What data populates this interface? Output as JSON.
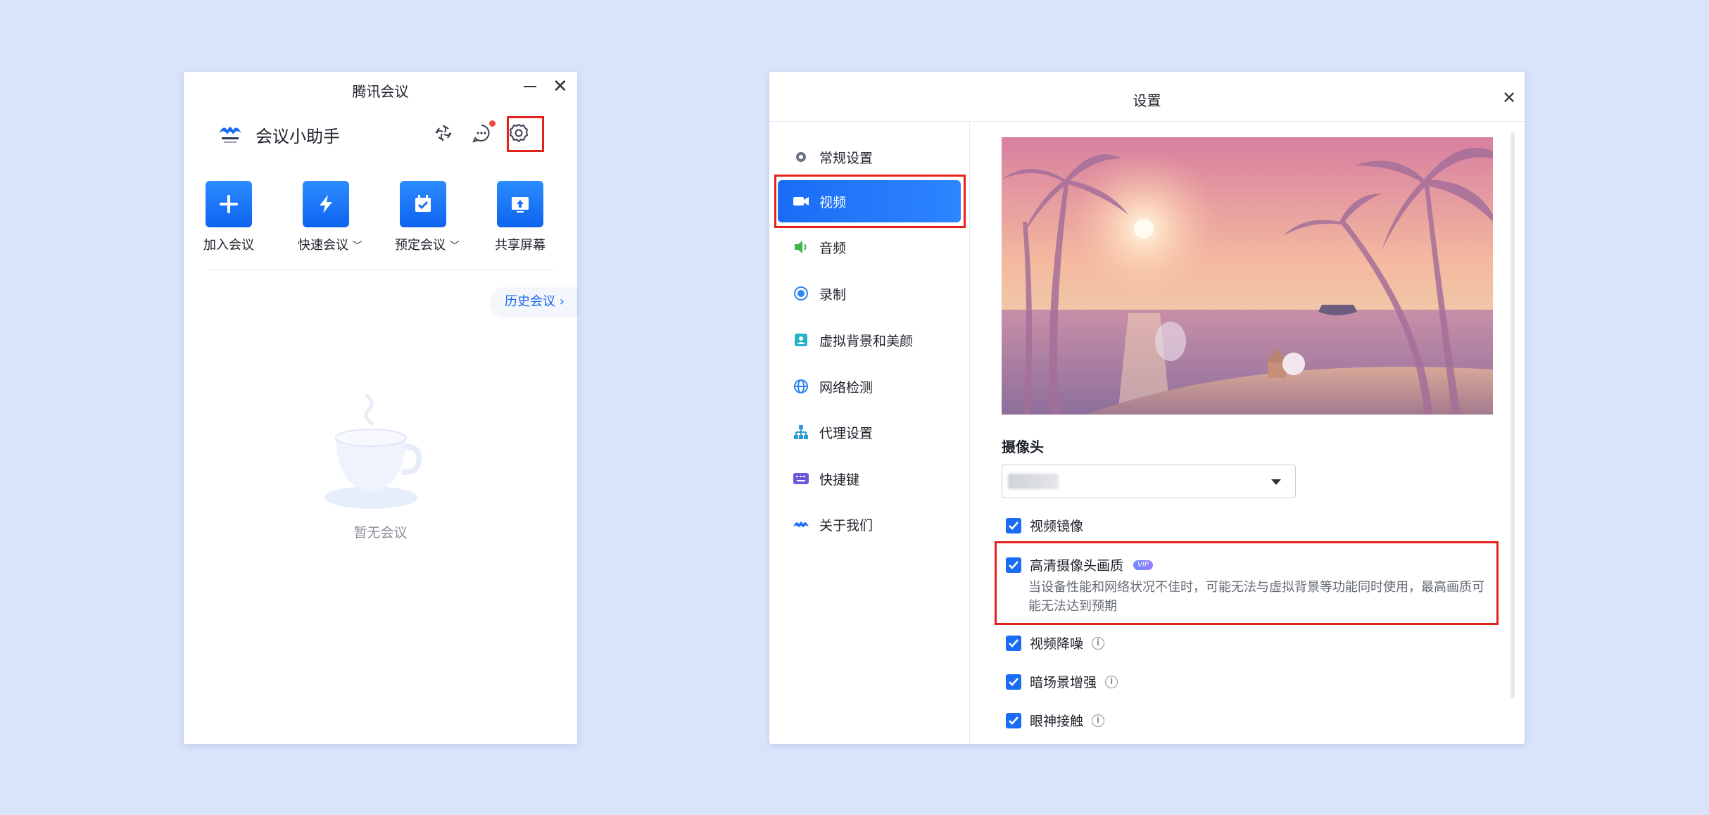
{
  "main_window": {
    "title": "腾讯会议",
    "assistant_name": "会议小助手",
    "actions": [
      {
        "label": "加入会议",
        "icon": "plus-icon",
        "has_dropdown": false
      },
      {
        "label": "快速会议",
        "icon": "lightning-icon",
        "has_dropdown": true
      },
      {
        "label": "预定会议",
        "icon": "calendar-check-icon",
        "has_dropdown": true
      },
      {
        "label": "共享屏幕",
        "icon": "share-screen-icon",
        "has_dropdown": false
      }
    ],
    "history_button": "历史会议",
    "empty_text": "暂无会议",
    "header_icons": [
      "sync-icon",
      "chat-icon",
      "gear-icon"
    ]
  },
  "settings_window": {
    "title": "设置",
    "nav": [
      {
        "label": "常规设置",
        "icon": "gear-icon"
      },
      {
        "label": "视频",
        "icon": "video-icon",
        "active": true
      },
      {
        "label": "音频",
        "icon": "speaker-icon"
      },
      {
        "label": "录制",
        "icon": "record-icon"
      },
      {
        "label": "虚拟背景和美颜",
        "icon": "portrait-icon"
      },
      {
        "label": "网络检测",
        "icon": "globe-icon"
      },
      {
        "label": "代理设置",
        "icon": "network-tree-icon"
      },
      {
        "label": "快捷键",
        "icon": "keyboard-icon"
      },
      {
        "label": "关于我们",
        "icon": "tencent-meeting-logo-icon"
      }
    ],
    "camera_label": "摄像头",
    "options": [
      {
        "label": "视频镜像",
        "checked": true,
        "info": false
      },
      {
        "label": "高清摄像头画质",
        "checked": true,
        "vip": "VIP",
        "description": "当设备性能和网络状况不佳时，可能无法与虚拟背景等功能同时使用，最高画质可能无法达到预期"
      },
      {
        "label": "视频降噪",
        "checked": true,
        "info": true
      },
      {
        "label": "暗场景增强",
        "checked": true,
        "info": true
      },
      {
        "label": "眼神接触",
        "checked": true,
        "info": true
      }
    ]
  },
  "colors": {
    "accent": "#1a6cf5",
    "highlight": "#e5211d",
    "background": "#d9e4fb"
  }
}
